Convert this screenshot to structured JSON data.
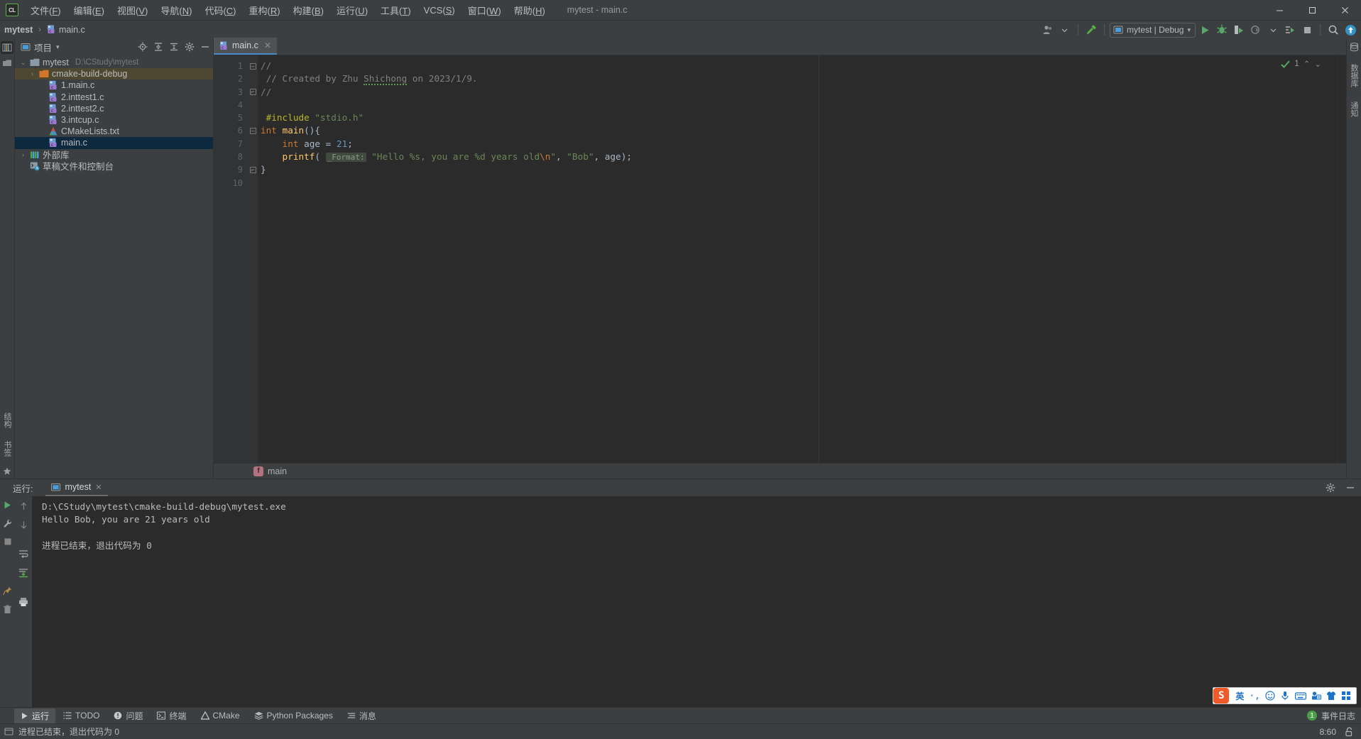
{
  "window": {
    "title": "mytest - main.c",
    "logo_text": "CL",
    "minimize_label": "—",
    "maximize_label": "▢",
    "close_label": "✕"
  },
  "menu": [
    {
      "label": "文件(F)",
      "name": "menu-file"
    },
    {
      "label": "编辑(E)",
      "name": "menu-edit"
    },
    {
      "label": "视图(V)",
      "name": "menu-view"
    },
    {
      "label": "导航(N)",
      "name": "menu-navigate"
    },
    {
      "label": "代码(C)",
      "name": "menu-code"
    },
    {
      "label": "重构(R)",
      "name": "menu-refactor"
    },
    {
      "label": "构建(B)",
      "name": "menu-build"
    },
    {
      "label": "运行(U)",
      "name": "menu-run"
    },
    {
      "label": "工具(T)",
      "name": "menu-tools"
    },
    {
      "label": "VCS(S)",
      "name": "menu-vcs"
    },
    {
      "label": "窗口(W)",
      "name": "menu-window"
    },
    {
      "label": "帮助(H)",
      "name": "menu-help"
    }
  ],
  "navbar": {
    "crumb_project": "mytest",
    "crumb_sep": "›",
    "crumb_file": "main.c"
  },
  "toolbar": {
    "run_config": "mytest | Debug",
    "dropdown_caret": "▾",
    "icons": [
      "user-avatar-icon",
      "chevron-down-icon",
      "hammer-build-icon",
      "run-icon",
      "debug-icon",
      "run-with-coverage-icon",
      "profile-icon",
      "profile-dropdown-icon",
      "attach-process-icon",
      "stop-icon",
      "search-everywhere-icon",
      "updates-icon"
    ]
  },
  "project_panel": {
    "title": "项目",
    "title_caret": "▾",
    "header_icons": [
      "locate-icon",
      "expand-all-icon",
      "collapse-all-icon",
      "settings-gear-icon",
      "hide-icon"
    ],
    "tree": [
      {
        "label": "mytest",
        "path": "D:\\CStudy\\mytest",
        "depth": 0,
        "arrow": "⌄",
        "icon": "folder-module-icon",
        "state": "none"
      },
      {
        "label": "cmake-build-debug",
        "path": "",
        "depth": 1,
        "arrow": "›",
        "icon": "folder-orange-icon",
        "state": "olive"
      },
      {
        "label": "1.main.c",
        "path": "",
        "depth": 2,
        "arrow": "",
        "icon": "c-file-icon",
        "state": "none"
      },
      {
        "label": "2.inttest1.c",
        "path": "",
        "depth": 2,
        "arrow": "",
        "icon": "c-file-icon",
        "state": "none"
      },
      {
        "label": "2.inttest2.c",
        "path": "",
        "depth": 2,
        "arrow": "",
        "icon": "c-file-icon",
        "state": "none"
      },
      {
        "label": "3.intcup.c",
        "path": "",
        "depth": 2,
        "arrow": "",
        "icon": "c-file-icon",
        "state": "none"
      },
      {
        "label": "CMakeLists.txt",
        "path": "",
        "depth": 2,
        "arrow": "",
        "icon": "cmake-file-icon",
        "state": "none"
      },
      {
        "label": "main.c",
        "path": "",
        "depth": 2,
        "arrow": "",
        "icon": "c-file-icon",
        "state": "blue"
      },
      {
        "label": "外部库",
        "path": "",
        "depth": 0,
        "arrow": "›",
        "icon": "external-libraries-icon",
        "state": "none"
      },
      {
        "label": "草稿文件和控制台",
        "path": "",
        "depth": 0,
        "arrow": "",
        "icon": "scratches-icon",
        "state": "none"
      }
    ]
  },
  "left_strip": {
    "labels": [
      "结构",
      "书签"
    ],
    "top_icons": [
      "project-tool-icon",
      "commit-icon"
    ]
  },
  "editor": {
    "tab_label": "main.c",
    "tab_close": "✕",
    "inspection_count": "1",
    "inspection_up": "⌃",
    "inspection_down": "⌄",
    "breadcrumb_badge": "f",
    "breadcrumb_label": "main",
    "line_numbers": [
      "1",
      "2",
      "3",
      "4",
      "5",
      "6",
      "7",
      "8",
      "9",
      "10"
    ],
    "code_lines": [
      {
        "n": 1,
        "tokens": [
          {
            "t": "//",
            "c": "k-comment"
          }
        ]
      },
      {
        "n": 2,
        "tokens": [
          {
            "t": " // Created by Zhu ",
            "c": "k-comment"
          },
          {
            "t": "Shichong",
            "c": "k-comment squig"
          },
          {
            "t": " on 2023/1/9.",
            "c": "k-comment"
          }
        ]
      },
      {
        "n": 3,
        "tokens": [
          {
            "t": "//",
            "c": "k-comment"
          }
        ]
      },
      {
        "n": 4,
        "tokens": []
      },
      {
        "n": 5,
        "tokens": [
          {
            "t": " #include ",
            "c": "k-macro"
          },
          {
            "t": "\"stdio.h\"",
            "c": "k-str"
          }
        ]
      },
      {
        "n": 6,
        "tokens": [
          {
            "t": "int ",
            "c": "k-kw"
          },
          {
            "t": "main",
            "c": "k-fn"
          },
          {
            "t": "(){",
            "c": "k-punct"
          }
        ]
      },
      {
        "n": 7,
        "tokens": [
          {
            "t": "    int ",
            "c": "k-kw"
          },
          {
            "t": "age ",
            "c": "k-plain"
          },
          {
            "t": "= ",
            "c": "k-plain"
          },
          {
            "t": "21",
            "c": "k-num"
          },
          {
            "t": ";",
            "c": "k-plain"
          }
        ]
      },
      {
        "n": 8,
        "tokens": [
          {
            "t": "    printf",
            "c": "k-fn"
          },
          {
            "t": "( ",
            "c": "k-plain"
          },
          {
            "t": "_Format:",
            "c": "param-hint"
          },
          {
            "t": " ",
            "c": "k-plain"
          },
          {
            "t": "\"Hello %s, you are %d years old",
            "c": "k-str"
          },
          {
            "t": "\\n",
            "c": "k-esc"
          },
          {
            "t": "\"",
            "c": "k-str"
          },
          {
            "t": ", ",
            "c": "k-plain"
          },
          {
            "t": "\"Bob\"",
            "c": "k-str"
          },
          {
            "t": ", ",
            "c": "k-plain"
          },
          {
            "t": "age",
            "c": "k-plain"
          },
          {
            "t": ");",
            "c": "k-plain"
          }
        ]
      },
      {
        "n": 9,
        "tokens": [
          {
            "t": "}",
            "c": "k-plain"
          }
        ]
      },
      {
        "n": 10,
        "tokens": []
      }
    ]
  },
  "right_strip": {
    "labels": [
      "数据库",
      "通知"
    ]
  },
  "run_panel": {
    "label": "运行:",
    "tab_label": "mytest",
    "tab_close": "✕",
    "settings_icon": "settings-gear-icon",
    "hide_icon": "hide-icon",
    "gutter_icons": [
      "rerun-icon",
      "wrench-settings-icon",
      "stop-icon",
      "pin-icon",
      "trash-icon"
    ],
    "gutter2_icons": [
      "scroll-up-icon",
      "scroll-down-icon",
      "soft-wrap-icon",
      "scroll-to-end-icon",
      "print-icon"
    ],
    "console_lines": [
      "D:\\CStudy\\mytest\\cmake-build-debug\\mytest.exe",
      "Hello Bob, you are 21 years old",
      "",
      "进程已结束，退出代码为 0"
    ]
  },
  "ime": {
    "logo": "S",
    "mode": "英",
    "icons": [
      "punctuation-icon",
      "emoji-icon",
      "microphone-icon",
      "keyboard-icon",
      "toolbox-icon",
      "skin-icon",
      "apps-icon"
    ]
  },
  "toolwindow_bar": {
    "buttons": [
      {
        "label": "运行",
        "icon": "run-icon",
        "active": true,
        "name": "toolwindow-run"
      },
      {
        "label": "TODO",
        "icon": "todo-icon",
        "active": false,
        "name": "toolwindow-todo"
      },
      {
        "label": "问题",
        "icon": "problems-icon",
        "active": false,
        "name": "toolwindow-problems"
      },
      {
        "label": "终端",
        "icon": "terminal-icon",
        "active": false,
        "name": "toolwindow-terminal"
      },
      {
        "label": "CMake",
        "icon": "cmake-icon",
        "active": false,
        "name": "toolwindow-cmake"
      },
      {
        "label": "Python Packages",
        "icon": "python-packages-icon",
        "active": false,
        "name": "toolwindow-python-packages"
      },
      {
        "label": "消息",
        "icon": "messages-icon",
        "active": false,
        "name": "toolwindow-messages"
      }
    ],
    "event_log": "事件日志",
    "event_count": "1"
  },
  "statusbar": {
    "message": "进程已结束，退出代码为 0",
    "caret_position": "8:60",
    "lock_icon": "unlocked-icon"
  },
  "colors": {
    "chrome": "#3c3f41",
    "editor_bg": "#2b2b2b",
    "gutter_bg": "#313335",
    "selection_blue": "#0d293e",
    "selection_olive": "#4e4833",
    "accent_tab": "#4a88c7",
    "green_run": "#59a869",
    "text": "#bbbbbb"
  }
}
